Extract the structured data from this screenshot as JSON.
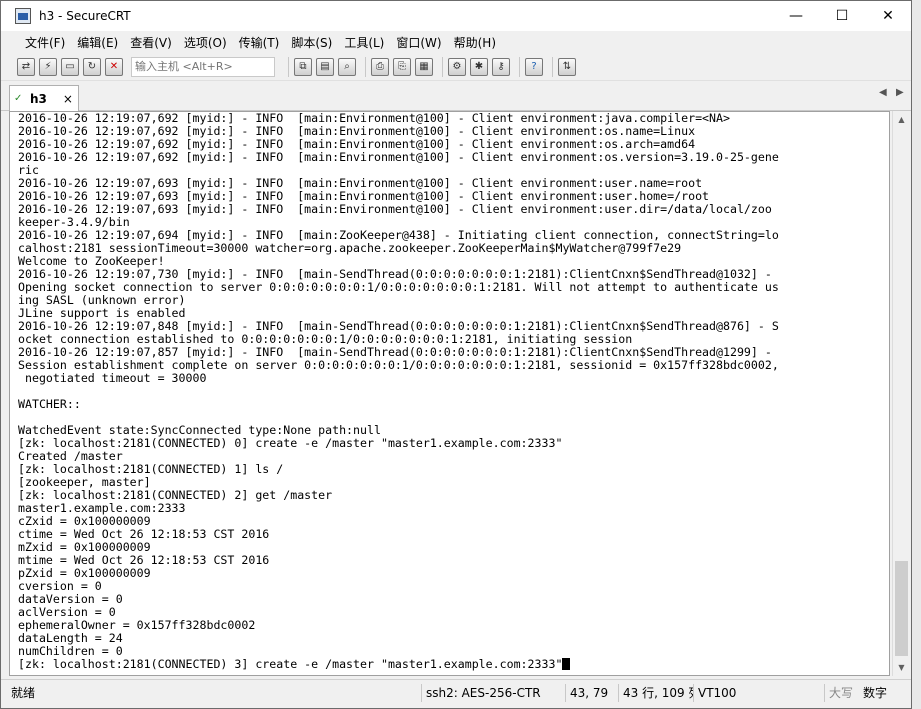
{
  "window": {
    "title": "h3 - SecureCRT"
  },
  "controls": {
    "minimize": "—",
    "maximize": "☐",
    "close": "✕"
  },
  "menu": [
    "文件(F)",
    "编辑(E)",
    "查看(V)",
    "选项(O)",
    "传输(T)",
    "脚本(S)",
    "工具(L)",
    "窗口(W)",
    "帮助(H)"
  ],
  "toolbar": {
    "host_placeholder": "输入主机 <Alt+R>",
    "icons": [
      "connect-icon",
      "quick-connect-icon",
      "connect-tab-icon",
      "reconnect-icon",
      "disconnect-icon",
      "copy-icon",
      "paste-icon",
      "find-icon",
      "print-icon",
      "print-selection-icon",
      "print-setup-icon",
      "session-options-icon",
      "global-options-icon",
      "keymap-icon",
      "help-icon",
      "sftp-icon"
    ]
  },
  "tab": {
    "label": "h3",
    "close": "×",
    "status": "✓"
  },
  "tab_nav": {
    "prev": "◀",
    "next": "▶"
  },
  "terminal": {
    "lines": [
      "2016-10-26 12:19:07,692 [myid:] - INFO  [main:Environment@100] - Client environment:java.compiler=<NA>",
      "2016-10-26 12:19:07,692 [myid:] - INFO  [main:Environment@100] - Client environment:os.name=Linux",
      "2016-10-26 12:19:07,692 [myid:] - INFO  [main:Environment@100] - Client environment:os.arch=amd64",
      "2016-10-26 12:19:07,692 [myid:] - INFO  [main:Environment@100] - Client environment:os.version=3.19.0-25-gene",
      "ric",
      "2016-10-26 12:19:07,693 [myid:] - INFO  [main:Environment@100] - Client environment:user.name=root",
      "2016-10-26 12:19:07,693 [myid:] - INFO  [main:Environment@100] - Client environment:user.home=/root",
      "2016-10-26 12:19:07,693 [myid:] - INFO  [main:Environment@100] - Client environment:user.dir=/data/local/zoo",
      "keeper-3.4.9/bin",
      "2016-10-26 12:19:07,694 [myid:] - INFO  [main:ZooKeeper@438] - Initiating client connection, connectString=lo",
      "calhost:2181 sessionTimeout=30000 watcher=org.apache.zookeeper.ZooKeeperMain$MyWatcher@799f7e29",
      "Welcome to ZooKeeper!",
      "2016-10-26 12:19:07,730 [myid:] - INFO  [main-SendThread(0:0:0:0:0:0:0:1:2181):ClientCnxn$SendThread@1032] -",
      "Opening socket connection to server 0:0:0:0:0:0:0:1/0:0:0:0:0:0:0:1:2181. Will not attempt to authenticate us",
      "ing SASL (unknown error)",
      "JLine support is enabled",
      "2016-10-26 12:19:07,848 [myid:] - INFO  [main-SendThread(0:0:0:0:0:0:0:1:2181):ClientCnxn$SendThread@876] - S",
      "ocket connection established to 0:0:0:0:0:0:0:1/0:0:0:0:0:0:0:1:2181, initiating session",
      "2016-10-26 12:19:07,857 [myid:] - INFO  [main-SendThread(0:0:0:0:0:0:0:1:2181):ClientCnxn$SendThread@1299] -",
      "Session establishment complete on server 0:0:0:0:0:0:0:1/0:0:0:0:0:0:0:1:2181, sessionid = 0x157ff328bdc0002,",
      " negotiated timeout = 30000",
      "",
      "WATCHER::",
      "",
      "WatchedEvent state:SyncConnected type:None path:null",
      "[zk: localhost:2181(CONNECTED) 0] create -e /master \"master1.example.com:2333\"",
      "Created /master",
      "[zk: localhost:2181(CONNECTED) 1] ls /",
      "[zookeeper, master]",
      "[zk: localhost:2181(CONNECTED) 2] get /master",
      "master1.example.com:2333",
      "cZxid = 0x100000009",
      "ctime = Wed Oct 26 12:18:53 CST 2016",
      "mZxid = 0x100000009",
      "mtime = Wed Oct 26 12:18:53 CST 2016",
      "pZxid = 0x100000009",
      "cversion = 0",
      "dataVersion = 0",
      "aclVersion = 0",
      "ephemeralOwner = 0x157ff328bdc0002",
      "dataLength = 24",
      "numChildren = 0"
    ],
    "prompt_line": "[zk: localhost:2181(CONNECTED) 3] create -e /master \"master1.example.com:2333\""
  },
  "statusbar": {
    "ready": "就绪",
    "protocol": "ssh2: AES-256-CTR",
    "cursor": "43,  79",
    "size": "43 行, 109 列",
    "emulation": "VT100",
    "caps": "大写",
    "num": "数字"
  }
}
